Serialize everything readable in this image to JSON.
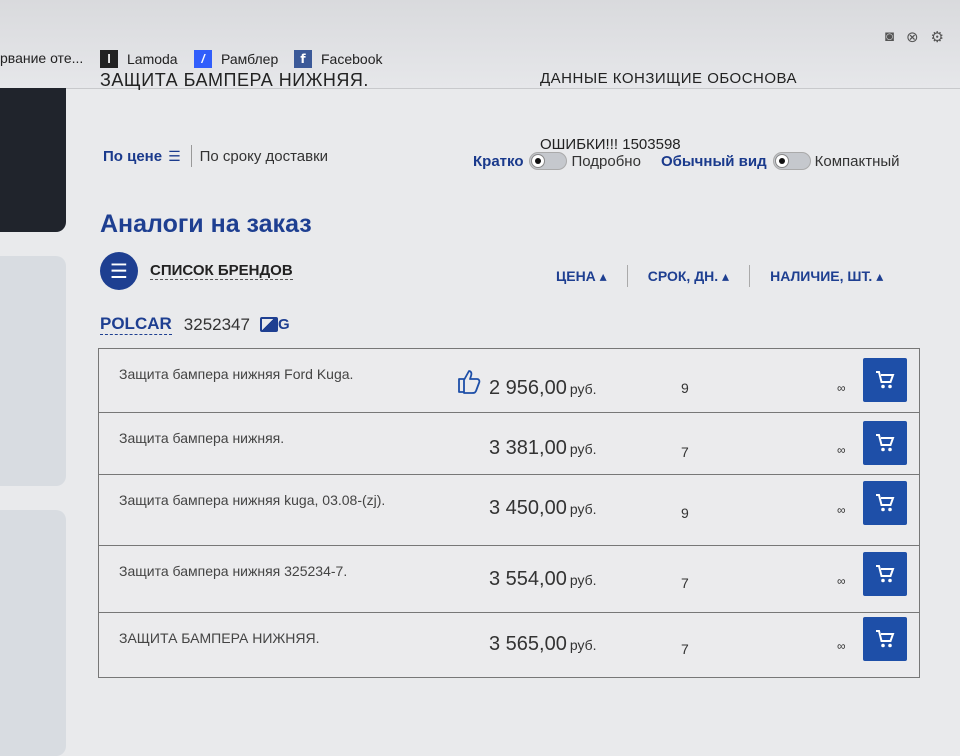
{
  "bookmarks": [
    {
      "label": "рвание оте..."
    },
    {
      "label": "Lamoda",
      "icon": "lamoda-icon"
    },
    {
      "label": "Рамблер",
      "icon": "rambler-icon"
    },
    {
      "label": "Facebook",
      "icon": "facebook-icon"
    }
  ],
  "header_cut_left": "ЗАЩИТА БАМПЕРА НИЖНЯЯ.",
  "header_cut_right": "ДАННЫЕ КОНЗИЩИЕ ОБОСНОВА",
  "sort": {
    "by_price": "По цене",
    "by_delivery": "По сроку доставки"
  },
  "errors": "ОШИБКИ!!! 1503598",
  "view_toggles": {
    "short": "Кратко",
    "detailed": "Подробно",
    "normal": "Обычный вид",
    "compact": "Компактный"
  },
  "section_title": "Аналоги на заказ",
  "brands_list_label": "СПИСОК БРЕНДОВ",
  "columns": {
    "price": "ЦЕНА",
    "term": "СРОК, ДН.",
    "stock": "НАЛИЧИЕ, ШТ."
  },
  "brand": {
    "name": "POLCAR",
    "number": "3252347",
    "image_icon_letter": "G"
  },
  "currency": "руб.",
  "items": [
    {
      "name": "Защита бампера нижняя Ford Kuga.",
      "price": "2 956,00",
      "days": "9",
      "stock": "∞",
      "recommended": true
    },
    {
      "name": "Защита бампера нижняя.",
      "price": "3 381,00",
      "days": "7",
      "stock": "∞"
    },
    {
      "name": "Защита бампера нижняя kuga, 03.08-(zj).",
      "price": "3 450,00",
      "days": "9",
      "stock": "∞"
    },
    {
      "name": "Защита бампера нижняя 325234-7.",
      "price": "3 554,00",
      "days": "7",
      "stock": "∞"
    },
    {
      "name": "ЗАЩИТА БАМПЕРА НИЖНЯЯ.",
      "price": "3 565,00",
      "days": "7",
      "stock": "∞"
    }
  ],
  "colors": {
    "accent": "#1e3f91",
    "cart_button": "#1e4fa8"
  }
}
